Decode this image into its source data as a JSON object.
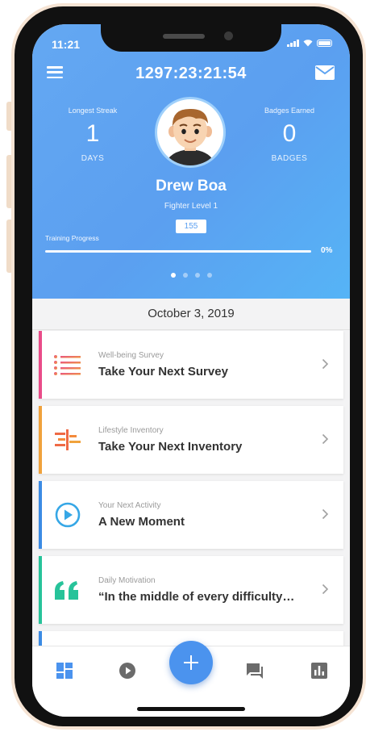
{
  "status_bar": {
    "time": "11:21"
  },
  "header": {
    "timer": "1297:23:21:54",
    "streak": {
      "title": "Longest Streak",
      "value": "1",
      "unit": "DAYS"
    },
    "badges": {
      "title": "Badges Earned",
      "value": "0",
      "unit": "BADGES"
    },
    "name": "Drew Boa",
    "level": "Fighter Level 1",
    "points": "155",
    "progress_label": "Training Progress",
    "progress_pct_text": "0%",
    "progress_fraction": 0
  },
  "date": "October 3, 2019",
  "cards": [
    {
      "label": "Well-being Survey",
      "title": "Take Your Next Survey",
      "icon": "list-icon",
      "accent": "#e94c89"
    },
    {
      "label": "Lifestyle Inventory",
      "title": "Take Your Next Inventory",
      "icon": "inventory-icon",
      "accent": "#f0a23c"
    },
    {
      "label": "Your Next Activity",
      "title": "A New Moment",
      "icon": "play-circle-icon",
      "accent": "#3b8be4"
    },
    {
      "label": "Daily Motivation",
      "title": "“In the middle of every difficulty…",
      "icon": "quote-icon",
      "accent": "#27c39a"
    }
  ],
  "bottom_nav": {
    "items": [
      "dashboard-icon",
      "play-icon",
      "add-icon",
      "chat-icon",
      "stats-icon"
    ],
    "active_color": "#4b93ee"
  }
}
